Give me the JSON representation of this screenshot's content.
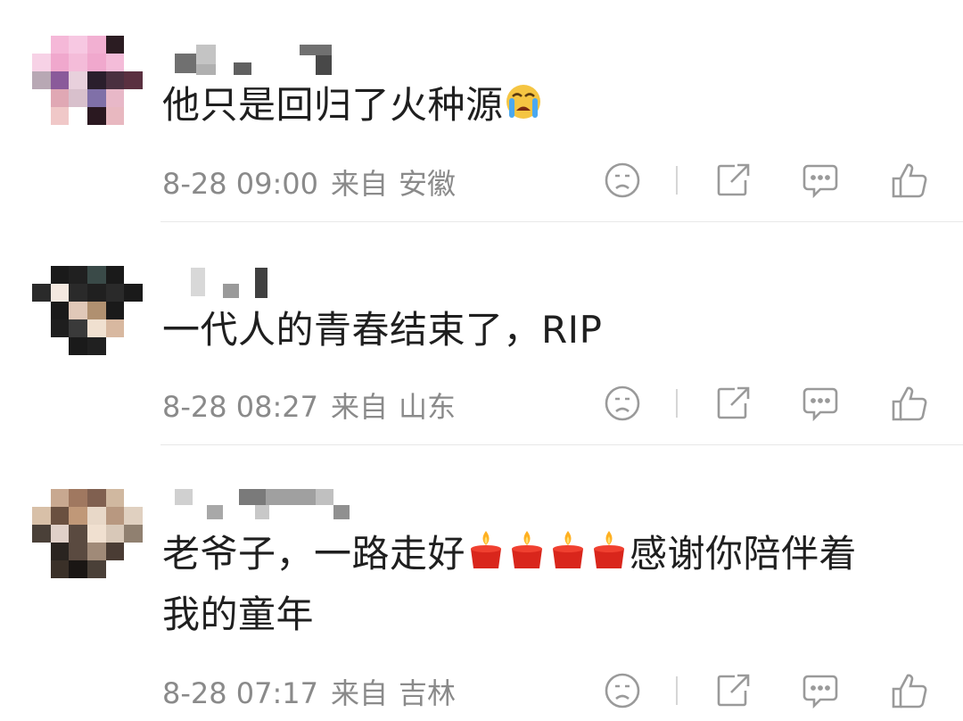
{
  "comments": [
    {
      "text": "他只是回归了火种源",
      "emoji": "crying-face-icon",
      "date": "8-28 09:00",
      "from_label": "来自",
      "region": "安徽"
    },
    {
      "text": "一代人的青春结束了，RIP",
      "date": "8-28 08:27",
      "from_label": "来自",
      "region": "山东"
    },
    {
      "text_line1_a": "老爷子，一路走好",
      "text_line1_b": "感谢你陪伴着",
      "text_line2": "我的童年",
      "emoji": "candle-icon",
      "date": "8-28 07:17",
      "from_label": "来自",
      "region": "吉林"
    }
  ],
  "actions": [
    "dislike-icon",
    "share-icon",
    "comment-icon",
    "like-icon"
  ],
  "colors": {
    "meta": "#8a8a8a",
    "icon": "#9a9a9a",
    "divider": "#e8e8e8",
    "candle": "#d9261c"
  }
}
